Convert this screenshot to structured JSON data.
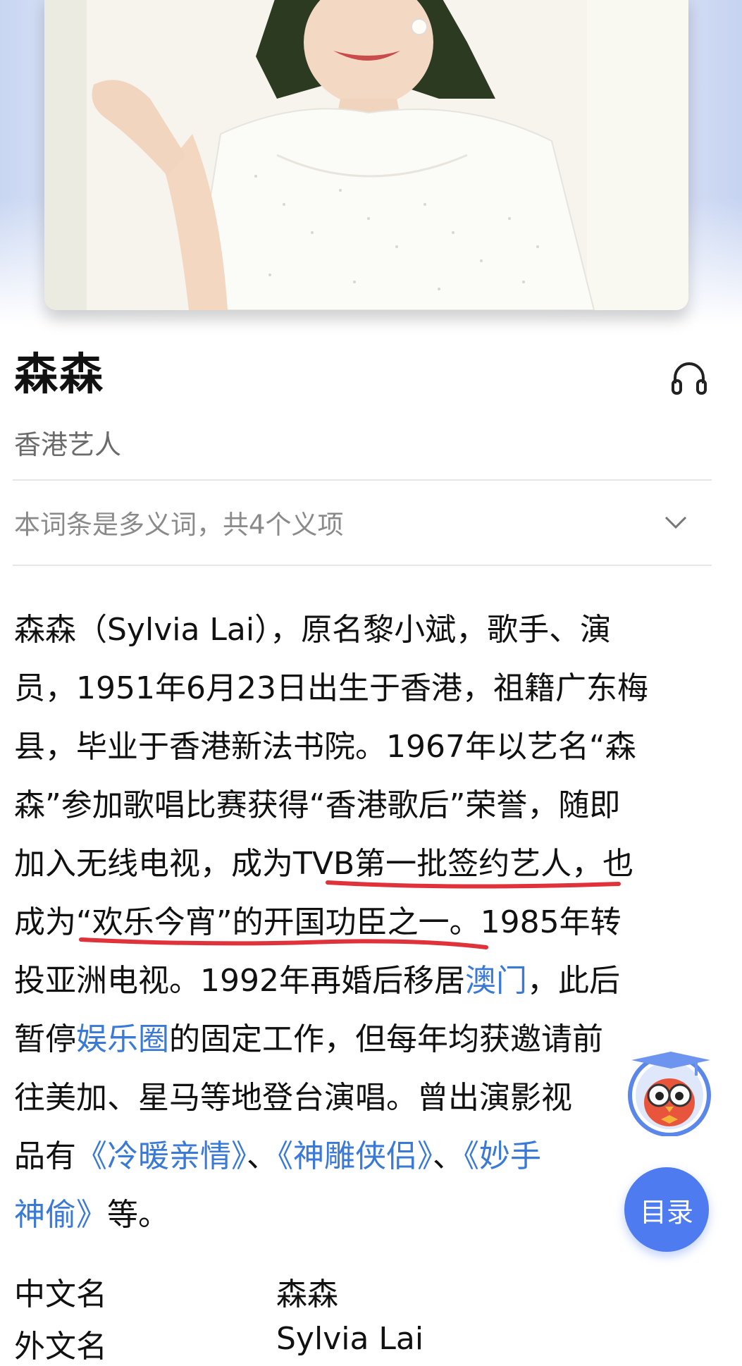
{
  "entry": {
    "title": "森森",
    "subtitle": "香港艺人",
    "polysemy_note": "本词条是多义词，共4个义项"
  },
  "intro": {
    "line1": "森森（Sylvia Lai），原名黎小斌，歌手、演",
    "line2": "员，1951年6月23日出生于香港，祖籍广东梅",
    "line3": "县，毕业于香港新法书院。1967年以艺名“森",
    "line4": "森”参加歌唱比赛获得“香港歌后”荣誉，随即",
    "line5": "加入无线电视，成为TVB第一批签约艺人，也",
    "line6": "成为“欢乐今宵”的开国功臣之一。1985年转",
    "line7a": "投亚洲电视。1992年再婚后移居",
    "line7_link": "澳门",
    "line7b": "，此后",
    "line8a": "暂停",
    "line8_link": "娱乐圈",
    "line8b": "的固定工作，但每年均获邀请前",
    "line9": "往美加、星马等地登台演唱。曾出演影视",
    "line10a": "品有",
    "line10_link1": "《冷暖亲情》",
    "line10_sep1": "、",
    "line10_link2": "《神雕侠侣》",
    "line10_sep2": "、",
    "line10_link3": "《妙手",
    "line11_link": "神偷》",
    "line11b": "等。"
  },
  "info_box": {
    "row1_label": "中文名",
    "row1_value": "森森",
    "row2_label": "外文名",
    "row2_value": "Sylvia Lai"
  },
  "floating": {
    "toc_label": "目录",
    "assistant_icon": "owl-mascot-icon"
  },
  "icons": {
    "audio": "headphones-icon",
    "expand": "chevron-down-icon"
  },
  "colors": {
    "link": "#3a7ad6",
    "toc_button": "#4e7cf0",
    "underline_annotation": "#e0323b"
  }
}
